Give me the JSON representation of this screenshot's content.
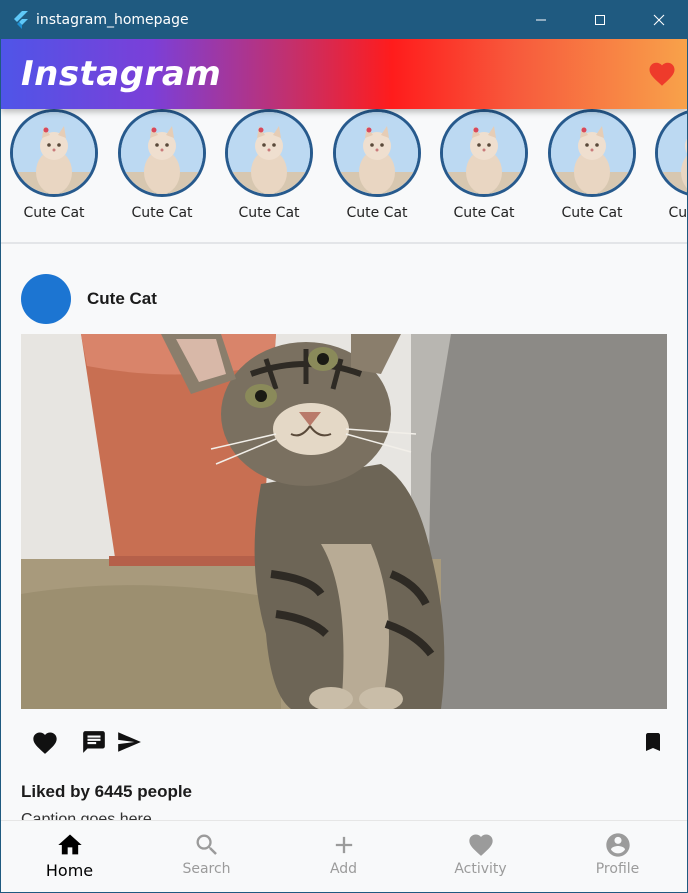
{
  "window": {
    "title": "instagram_homepage"
  },
  "app": {
    "brand": "Instagram",
    "colors": {
      "gradient": [
        "#4f55e8",
        "#7b3fd8",
        "#ff1c1c",
        "#f8a24a"
      ],
      "heart": "#ee3b2b",
      "avatar": "#1c75d2"
    }
  },
  "stories": [
    {
      "name": "Cute Cat"
    },
    {
      "name": "Cute Cat"
    },
    {
      "name": "Cute Cat"
    },
    {
      "name": "Cute Cat"
    },
    {
      "name": "Cute Cat"
    },
    {
      "name": "Cute Cat"
    },
    {
      "name": "Cute Cat"
    }
  ],
  "post": {
    "username": "Cute Cat",
    "likes_text": "Liked by 6445 people",
    "caption": "Caption goes here"
  },
  "bottom_nav": {
    "items": [
      {
        "label": "Home",
        "icon": "home-icon",
        "active": true
      },
      {
        "label": "Search",
        "icon": "search-icon",
        "active": false
      },
      {
        "label": "Add",
        "icon": "add-icon",
        "active": false
      },
      {
        "label": "Activity",
        "icon": "heart-icon",
        "active": false
      },
      {
        "label": "Profile",
        "icon": "profile-icon",
        "active": false
      }
    ]
  }
}
